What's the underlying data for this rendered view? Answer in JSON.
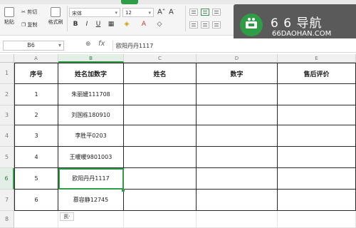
{
  "ribbon": {
    "cut_label": "剪切",
    "copy_label": "复制",
    "paste_label": "粘贴",
    "format_painter_label": "格式刷",
    "font_name": "宋体",
    "font_size": "12"
  },
  "logo": {
    "title": "6 6 导航",
    "subtitle": "66DAOHAN.COM"
  },
  "formula_bar": {
    "cell_ref": "B6",
    "fx_label": "fx",
    "value": "欧阳丹丹1117"
  },
  "columns": [
    "A",
    "B",
    "C",
    "D",
    "E"
  ],
  "rows": [
    "1",
    "2",
    "3",
    "4",
    "5",
    "6",
    "7",
    "8"
  ],
  "table": {
    "headers": [
      "序号",
      "姓名加数字",
      "姓名",
      "数字",
      "售后评价"
    ],
    "body": [
      [
        "1",
        "朱丽媛111708",
        "",
        "",
        ""
      ],
      [
        "2",
        "刘国栋180910",
        "",
        "",
        ""
      ],
      [
        "3",
        "李胜平0203",
        "",
        "",
        ""
      ],
      [
        "4",
        "王暖暖9801003",
        "",
        "",
        ""
      ],
      [
        "5",
        "欧阳丹丹1117",
        "",
        "",
        ""
      ],
      [
        "6",
        "慕容静12745",
        "",
        "",
        ""
      ]
    ]
  },
  "paste_options_label": "凯·",
  "colors": {
    "accent": "#2f9d46",
    "logo_bg": "#5a5a5a"
  }
}
